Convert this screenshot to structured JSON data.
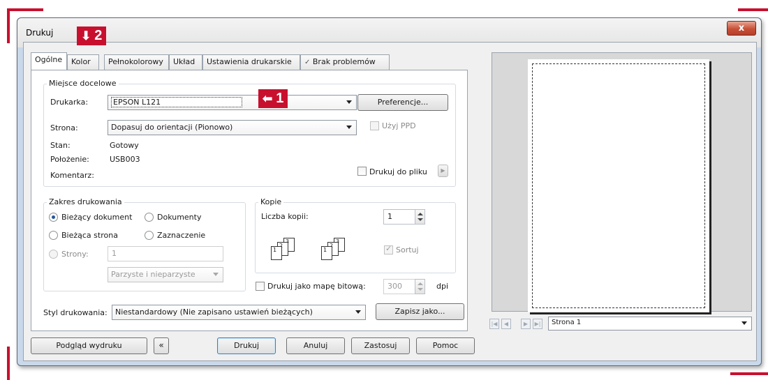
{
  "window": {
    "title": "Drukuj",
    "close": "x"
  },
  "callouts": {
    "printer": "1",
    "title": "2"
  },
  "tabs": [
    "Ogólne",
    "Kolor",
    "Pełnokolorowy",
    "Układ",
    "Ustawienia drukarskie",
    "Brak problemów"
  ],
  "destination": {
    "group_title": "Miejsce docelowe",
    "printer_label": "Drukarka:",
    "printer_value": "EPSON L121",
    "preferences_button": "Preferencje...",
    "page_label": "Strona:",
    "page_value": "Dopasuj do orientacji (Pionowo)",
    "use_ppd_label": "Użyj PPD",
    "status_label": "Stan:",
    "status_value": "Gotowy",
    "location_label": "Położenie:",
    "location_value": "USB003",
    "comment_label": "Komentarz:",
    "print_to_file_label": "Drukuj do pliku"
  },
  "range": {
    "group_title": "Zakres drukowania",
    "current_document": "Bieżący dokument",
    "documents": "Dokumenty",
    "current_page": "Bieżąca strona",
    "selection": "Zaznaczenie",
    "pages_label": "Strony:",
    "pages_value": "1",
    "odd_even_value": "Parzyste i nieparzyste",
    "selected": "current_document"
  },
  "copies": {
    "group_title": "Kopie",
    "count_label": "Liczba kopii:",
    "count_value": "1",
    "collate_label": "Sortuj",
    "collate_checked": true,
    "page_numbers": [
      "1",
      "2",
      "3"
    ]
  },
  "bitmap": {
    "label": "Drukuj jako mapę bitową:",
    "dpi_value": "300",
    "dpi_unit": "dpi"
  },
  "style": {
    "label": "Styl drukowania:",
    "value": "Niestandardowy (Nie zapisano ustawień bieżących)",
    "save_as_button": "Zapisz jako..."
  },
  "footer": {
    "preview_button": "Podgląd wydruku",
    "collapse_icon": "«",
    "print_button": "Drukuj",
    "cancel_button": "Anuluj",
    "apply_button": "Zastosuj",
    "help_button": "Pomoc"
  },
  "preview": {
    "page_select_value": "Strona 1"
  },
  "colors": {
    "accent_red": "#c8102e",
    "window_frame": "#c9d8ea",
    "dialog_bg": "#f0f0f0"
  }
}
